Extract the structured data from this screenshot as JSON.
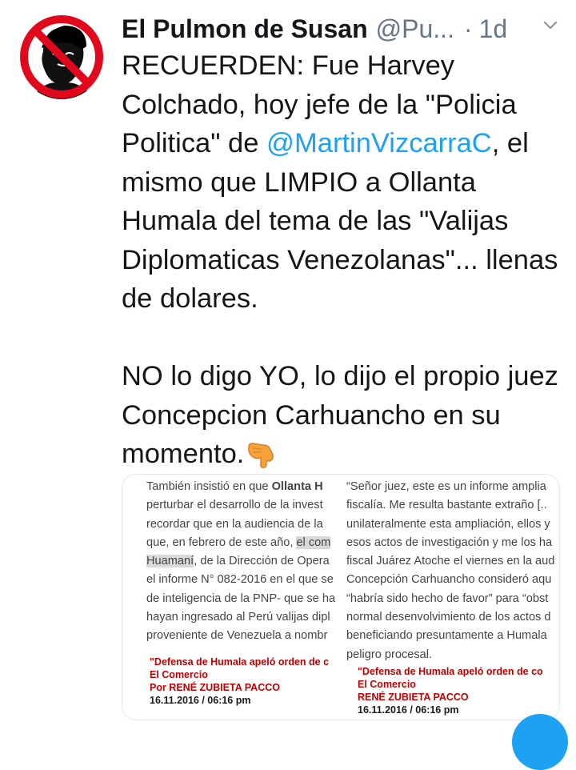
{
  "tweet": {
    "display_name": "El Pulmon de Susan",
    "handle": "@Pu...",
    "separator": "·",
    "timestamp": "1d",
    "paragraph1": {
      "before_mention": "RECUERDEN: Fue Harvey Colchado, hoy jefe de la \"Policia Politica\" de ",
      "mention": "@MartinVizcarraC",
      "after_mention": ", el mismo que LIMPIO a Ollanta Humala del tema de las \"Valijas Diplomaticas Venezolanas\"... llenas de dolares."
    },
    "paragraph2": "NO lo digo YO, lo dijo el propio juez Concepcion Carhuancho en su momento.",
    "emoji": "backhand-index-pointing-down",
    "colors": {
      "accent": "#1da1f2",
      "text": "#14171a",
      "secondary": "#657786",
      "caption_red": "#c00000"
    }
  },
  "media": {
    "left": {
      "lines": [
        {
          "pre": "También insistió en que ",
          "bold": "Ollanta H",
          "post": ""
        },
        {
          "pre": "perturbar el desarrollo de la invest",
          "bold": "",
          "post": ""
        },
        {
          "pre": "recordar que en la audiencia de la ",
          "bold": "",
          "post": ""
        },
        {
          "pre": "que, en febrero de este año, ",
          "highlight": "el com",
          "post": ""
        },
        {
          "pre": "",
          "highlight": "Huamaní",
          "post": ", de la Dirección de Opera"
        },
        {
          "pre": "el informe N° 082-2016 en el que se",
          "bold": "",
          "post": ""
        },
        {
          "pre": "de inteligencia de la PNP- que se ha",
          "bold": "",
          "post": ""
        },
        {
          "pre": "hayan ingresado al Perú valijas dipl",
          "bold": "",
          "post": ""
        },
        {
          "pre": "proveniente de Venezuela a nombr",
          "bold": "",
          "post": ""
        }
      ],
      "caption": {
        "title": "\"Defensa de Humala apeló orden de c",
        "source": "El Comercio",
        "author": "Por RENÉ ZUBIETA PACCO",
        "date": "16.11.2016 / 06:16 pm"
      }
    },
    "right": {
      "lines": [
        "“Señor juez, este es un informe amplia",
        "fiscalía. Me resulta bastante extraño [..",
        "unilateralmente esta ampliación, ellos y",
        "esos actos de investigación y me los ha",
        "fiscal Juárez Atoche el viernes en la aud",
        "Concepción Carhuancho consideró aqu",
        "“habría sido hecho de favor” para “obst",
        "normal desenvolvimiento de los actos d",
        "beneficiando presuntamente a Humala",
        "peligro procesal."
      ],
      "caption": {
        "title": "\"Defensa de Humala apeló orden de co",
        "source": "El Comercio",
        "author": "RENÉ ZUBIETA PACCO",
        "date": "16.11.2016 / 06:16 pm"
      }
    }
  }
}
